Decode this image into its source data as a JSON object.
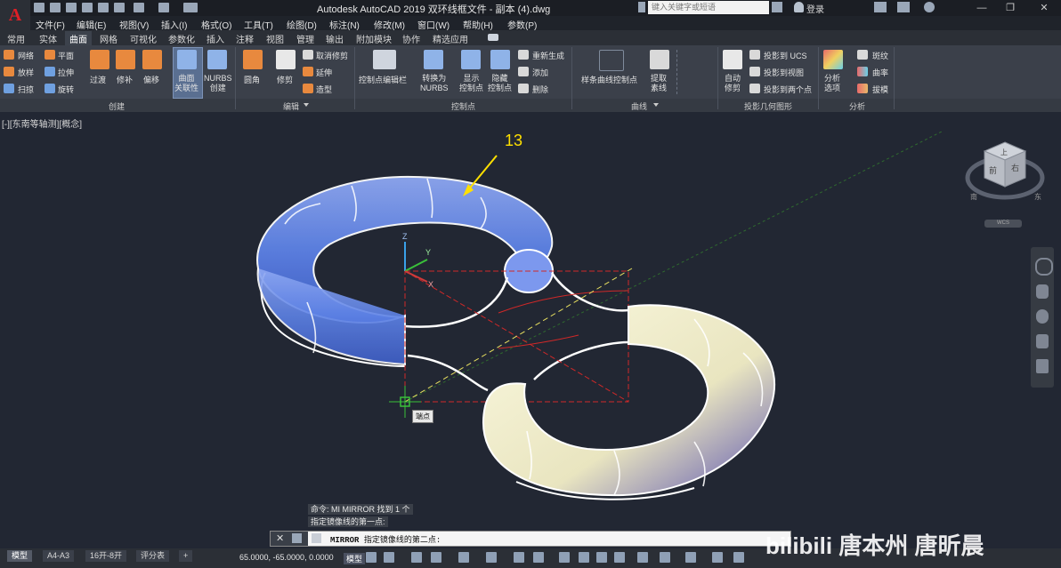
{
  "title": {
    "app_logo": "A",
    "text": "Autodesk AutoCAD 2019   双环线框文件 - 副本 (4).dwg",
    "search_placeholder": "键入关键字或短语",
    "login": "登录"
  },
  "menu": [
    "文件(F)",
    "编辑(E)",
    "视图(V)",
    "插入(I)",
    "格式(O)",
    "工具(T)",
    "绘图(D)",
    "标注(N)",
    "修改(M)",
    "窗口(W)",
    "帮助(H)",
    "参数(P)"
  ],
  "tabs": [
    "常用",
    "实体",
    "曲面",
    "网格",
    "可视化",
    "参数化",
    "插入",
    "注释",
    "视图",
    "管理",
    "输出",
    "附加模块",
    "协作",
    "精选应用"
  ],
  "active_tab": "曲面",
  "ribbon": {
    "create": {
      "title": "创建",
      "small": [
        "网络",
        "放样",
        "扫掠",
        "平面",
        "拉伸",
        "旋转"
      ],
      "large": [
        "过渡",
        "修补",
        "偏移",
        "曲面\n关联性",
        "NURBS\n创建"
      ]
    },
    "edit": {
      "title": "编辑",
      "large": [
        "圆角",
        "修剪"
      ],
      "small": [
        "取消修剪",
        "延伸",
        "造型"
      ]
    },
    "control_points": {
      "title": "控制点",
      "large": [
        "控制点编辑栏",
        "转换为\nNURBS",
        "显示\n控制点",
        "隐藏\n控制点"
      ],
      "small": [
        "重新生成",
        "添加",
        "删除"
      ]
    },
    "curves": {
      "title": "曲线",
      "large": [
        "样条曲线控制点",
        "提取\n素线"
      ]
    },
    "projection": {
      "title": "投影几何图形",
      "large": [
        "自动\n修剪"
      ],
      "small": [
        "投影到 UCS",
        "投影到视图",
        "投影到两个点"
      ]
    },
    "analysis": {
      "title": "分析",
      "large": [
        "分析\n选项"
      ],
      "small": [
        "斑纹",
        "曲率",
        "拔模"
      ]
    }
  },
  "viewport": {
    "label": "[-][东南等轴测][概念]",
    "annotation": "13",
    "snap_tooltip": "端点",
    "viewcube": {
      "top": "上",
      "front": "前",
      "right": "右",
      "south": "南",
      "east": "东",
      "wcs": "WCS"
    },
    "ucs_labels": {
      "x": "X",
      "y": "Y",
      "z": "Z"
    }
  },
  "command": {
    "history_1": "命令: MI MIRROR 找到 1 个",
    "history_2": "指定镜像线的第一点:",
    "prompt_keyword": "MIRROR",
    "prompt_text": "指定镜像线的第二点:"
  },
  "status": {
    "layout_tabs": [
      "模型",
      "A4-A3",
      "16开-8开",
      "评分表"
    ],
    "add_tab": "+",
    "coords": "65.0000, -65.0000, 0.0000",
    "model_label": "模型"
  },
  "watermark": "bilibili 唐本州 唐昕晨",
  "colors": {
    "background": "#222733",
    "ribbon": "#3b404a",
    "torus_blue": "#6b8fe8",
    "torus_cream": "#f3efcc",
    "annotation": "#ffe000"
  }
}
